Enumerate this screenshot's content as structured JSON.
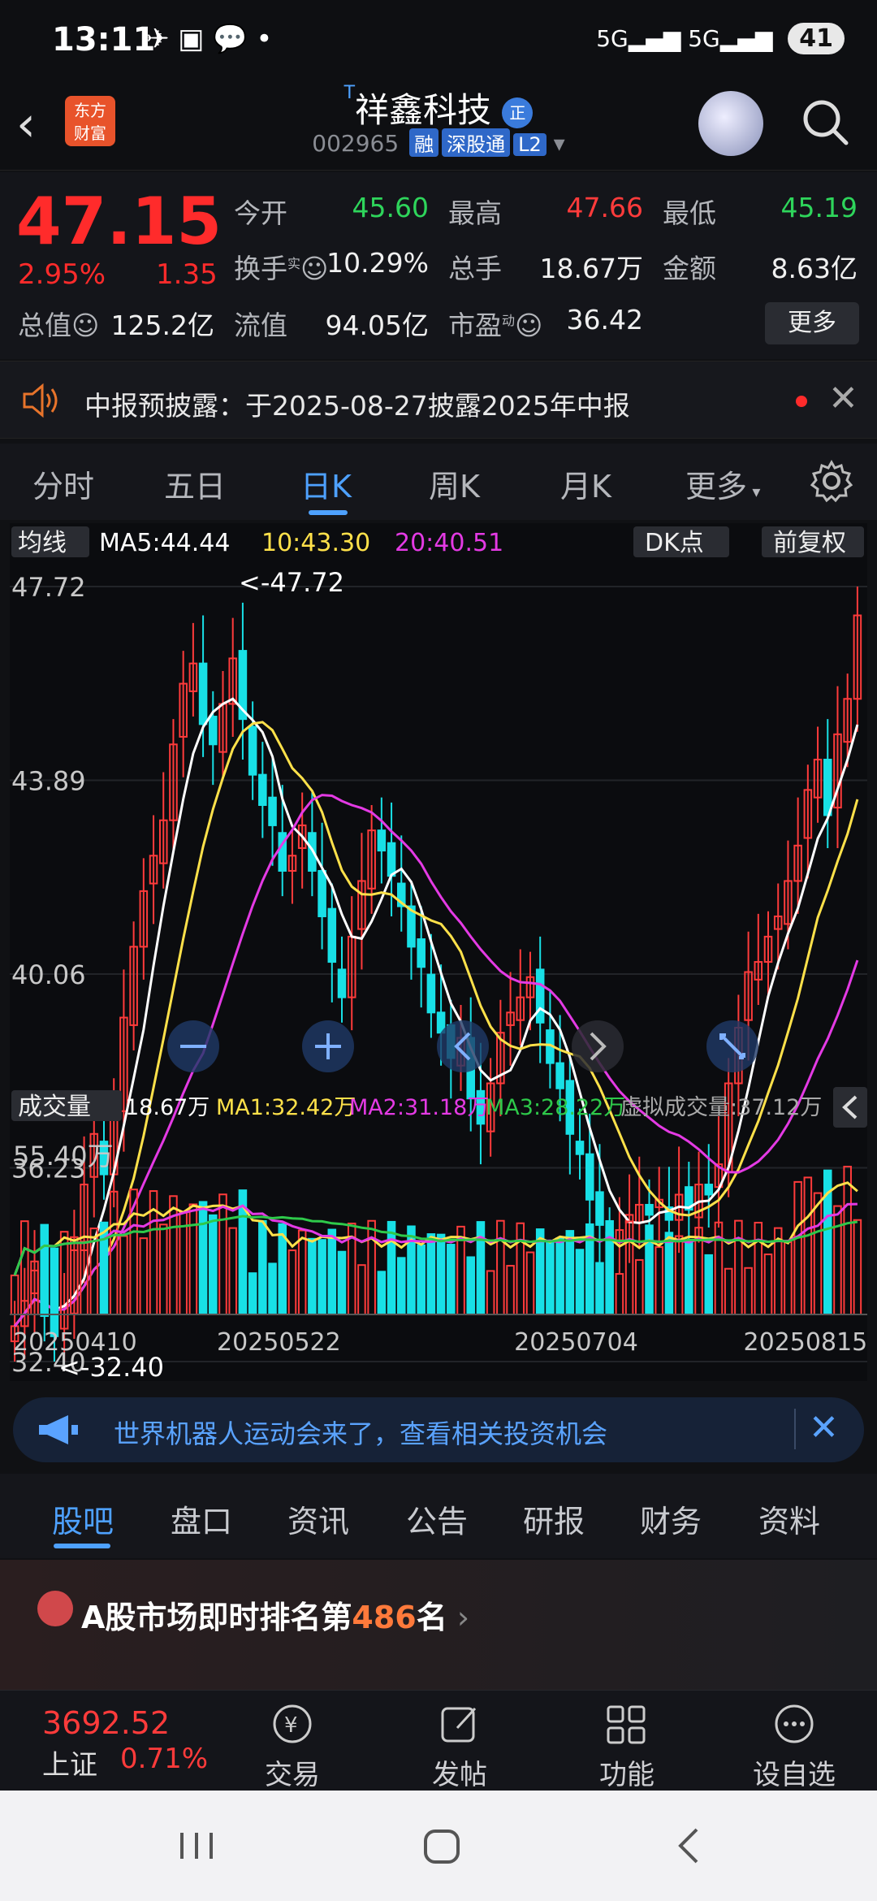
{
  "status": {
    "time": "13:11",
    "battery": "41",
    "net1": "5G",
    "net2": "5G"
  },
  "header": {
    "title": "祥鑫科技",
    "title_prefix": "T",
    "badge": "正",
    "code": "002965",
    "tags": [
      "融",
      "深股通",
      "L2"
    ],
    "logo_line1": "东方",
    "logo_line2": "财富"
  },
  "quote": {
    "price": "47.15",
    "pct": "2.95%",
    "chg": "1.35",
    "open_label": "今开",
    "open": "45.60",
    "high_label": "最高",
    "high": "47.66",
    "low_label": "最低",
    "low": "45.19",
    "turnover_label": "换手",
    "turnover_sup": "实",
    "turnover": "10.29%",
    "volume_label": "总手",
    "volume": "18.67万",
    "amount_label": "金额",
    "amount": "8.63亿",
    "mktcap_label": "总值",
    "mktcap": "125.2亿",
    "float_label": "流值",
    "float": "94.05亿",
    "pe_label": "市盈",
    "pe_sup": "动",
    "pe": "36.42",
    "more": "更多"
  },
  "notice": {
    "text": "中报预披露：于2025-08-27披露2025年中报"
  },
  "period_tabs": [
    "分时",
    "五日",
    "日K",
    "周K",
    "月K",
    "更多"
  ],
  "chart_bar": {
    "junxian": "均线",
    "ma5": "MA5:44.44",
    "ma10": "10:43.30",
    "ma20": "20:40.51",
    "dk": "DK点",
    "fq": "前复权"
  },
  "vol_bar": {
    "label": "成交量",
    "v": "18.67万",
    "ma1": "MA1:32.42万",
    "ma2": "MA2:31.18万",
    "ma3": "MA3:28.22万",
    "virtual": "虚拟成交量:37.12万",
    "max": "55.40万"
  },
  "chart_data": {
    "type": "candlestick",
    "y_ticks": [
      "47.72",
      "43.89",
      "40.06",
      "36.23",
      "32.40"
    ],
    "ylim": [
      32.4,
      47.72
    ],
    "max_label": "<-47.72",
    "min_label": "<-32.40",
    "x_ticks": [
      "20250410",
      "20250522",
      "20250704",
      "20250815"
    ],
    "series": [
      {
        "name": "MA5",
        "color": "#ffffff"
      },
      {
        "name": "MA10",
        "color": "#ffe14a"
      },
      {
        "name": "MA20",
        "color": "#e43ae4"
      }
    ],
    "close": [
      33.1,
      33.6,
      34.2,
      33.3,
      32.9,
      33.5,
      34.6,
      35.9,
      36.9,
      36.1,
      37.2,
      39.2,
      40.6,
      41.7,
      42.4,
      43.1,
      44.6,
      45.8,
      46.2,
      45.0,
      44.6,
      45.4,
      46.3,
      45.1,
      44.0,
      43.4,
      43.0,
      42.1,
      42.4,
      43.0,
      42.1,
      41.2,
      40.3,
      39.6,
      40.8,
      41.9,
      42.9,
      42.5,
      42.0,
      41.4,
      40.6,
      40.2,
      39.3,
      38.9,
      38.4,
      38.8,
      37.6,
      37.1,
      37.9,
      38.9,
      39.3,
      39.6,
      40.0,
      39.1,
      38.3,
      37.8,
      36.9,
      36.5,
      35.6,
      35.1,
      34.8,
      35.0,
      35.3,
      35.5,
      35.3,
      35.6,
      35.2,
      35.7,
      35.4,
      35.9,
      35.7,
      36.3,
      37.9,
      39.0,
      40.1,
      40.3,
      40.8,
      41.2,
      41.9,
      42.6,
      43.7,
      44.3,
      43.2,
      44.8,
      45.5,
      47.15
    ],
    "volume_ma1_current": "32.42万",
    "volume_max": "55.40万"
  },
  "promo": {
    "text": "世界机器人运动会来了，查看相关投资机会"
  },
  "bottom_tabs": [
    "股吧",
    "盘口",
    "资讯",
    "公告",
    "研报",
    "财务",
    "资料"
  ],
  "rank": {
    "prefix": "A股市场即时排名第",
    "num": "486",
    "suffix": "名"
  },
  "index": {
    "value": "3692.52",
    "name": "上证",
    "pct": "0.71%"
  },
  "bottom_nav": [
    "交易",
    "发帖",
    "功能",
    "设自选"
  ],
  "colors": {
    "up": "#ff3b3b",
    "down": "#18e0e6",
    "accent": "#4ea1ff"
  }
}
